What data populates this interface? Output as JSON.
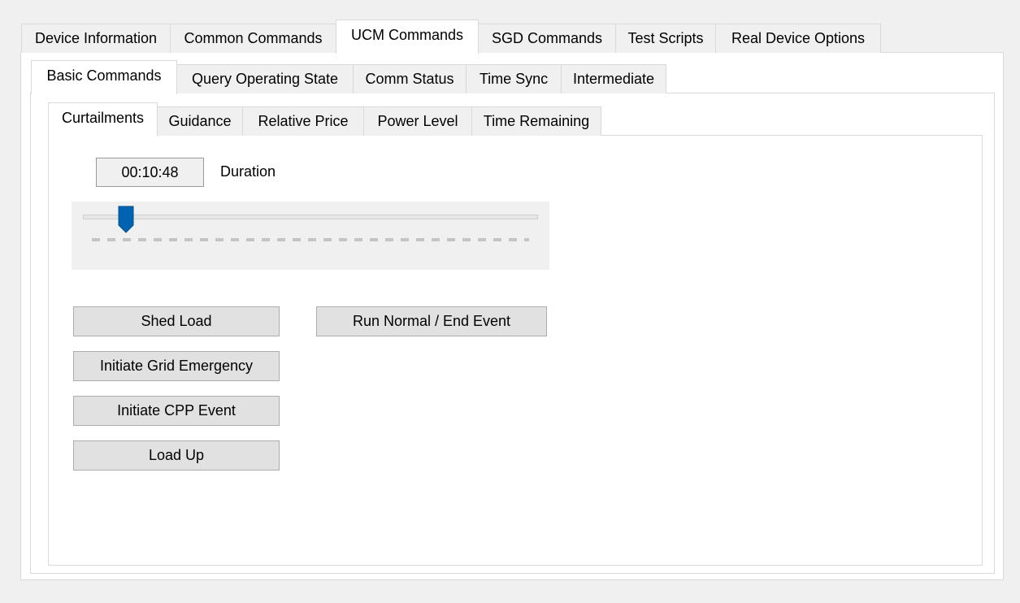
{
  "main_tabs": [
    {
      "label": "Device Information",
      "active": false
    },
    {
      "label": "Common Commands",
      "active": false
    },
    {
      "label": "UCM Commands",
      "active": true
    },
    {
      "label": "SGD Commands",
      "active": false
    },
    {
      "label": "Test Scripts",
      "active": false
    },
    {
      "label": "Real Device Options",
      "active": false
    }
  ],
  "ucm_tabs": [
    {
      "label": "Basic Commands",
      "active": true
    },
    {
      "label": "Query Operating State",
      "active": false
    },
    {
      "label": "Comm Status",
      "active": false
    },
    {
      "label": "Time Sync",
      "active": false
    },
    {
      "label": "Intermediate",
      "active": false
    }
  ],
  "basic_tabs": [
    {
      "label": "Curtailments",
      "active": true
    },
    {
      "label": "Guidance",
      "active": false
    },
    {
      "label": "Relative Price",
      "active": false
    },
    {
      "label": "Power Level",
      "active": false
    },
    {
      "label": "Time Remaining",
      "active": false
    }
  ],
  "curtailments": {
    "duration_value": "00:10:48",
    "duration_label": "Duration",
    "slider_fraction": 0.08,
    "buttons": {
      "shed_load": "Shed Load",
      "run_normal": "Run Normal / End Event",
      "grid_emergency": "Initiate Grid Emergency",
      "cpp_event": "Initiate CPP Event",
      "load_up": "Load Up"
    }
  },
  "colors": {
    "slider_thumb": "#0063b1",
    "button_face": "#e1e1e1",
    "window_bg": "#f0f0f0"
  }
}
